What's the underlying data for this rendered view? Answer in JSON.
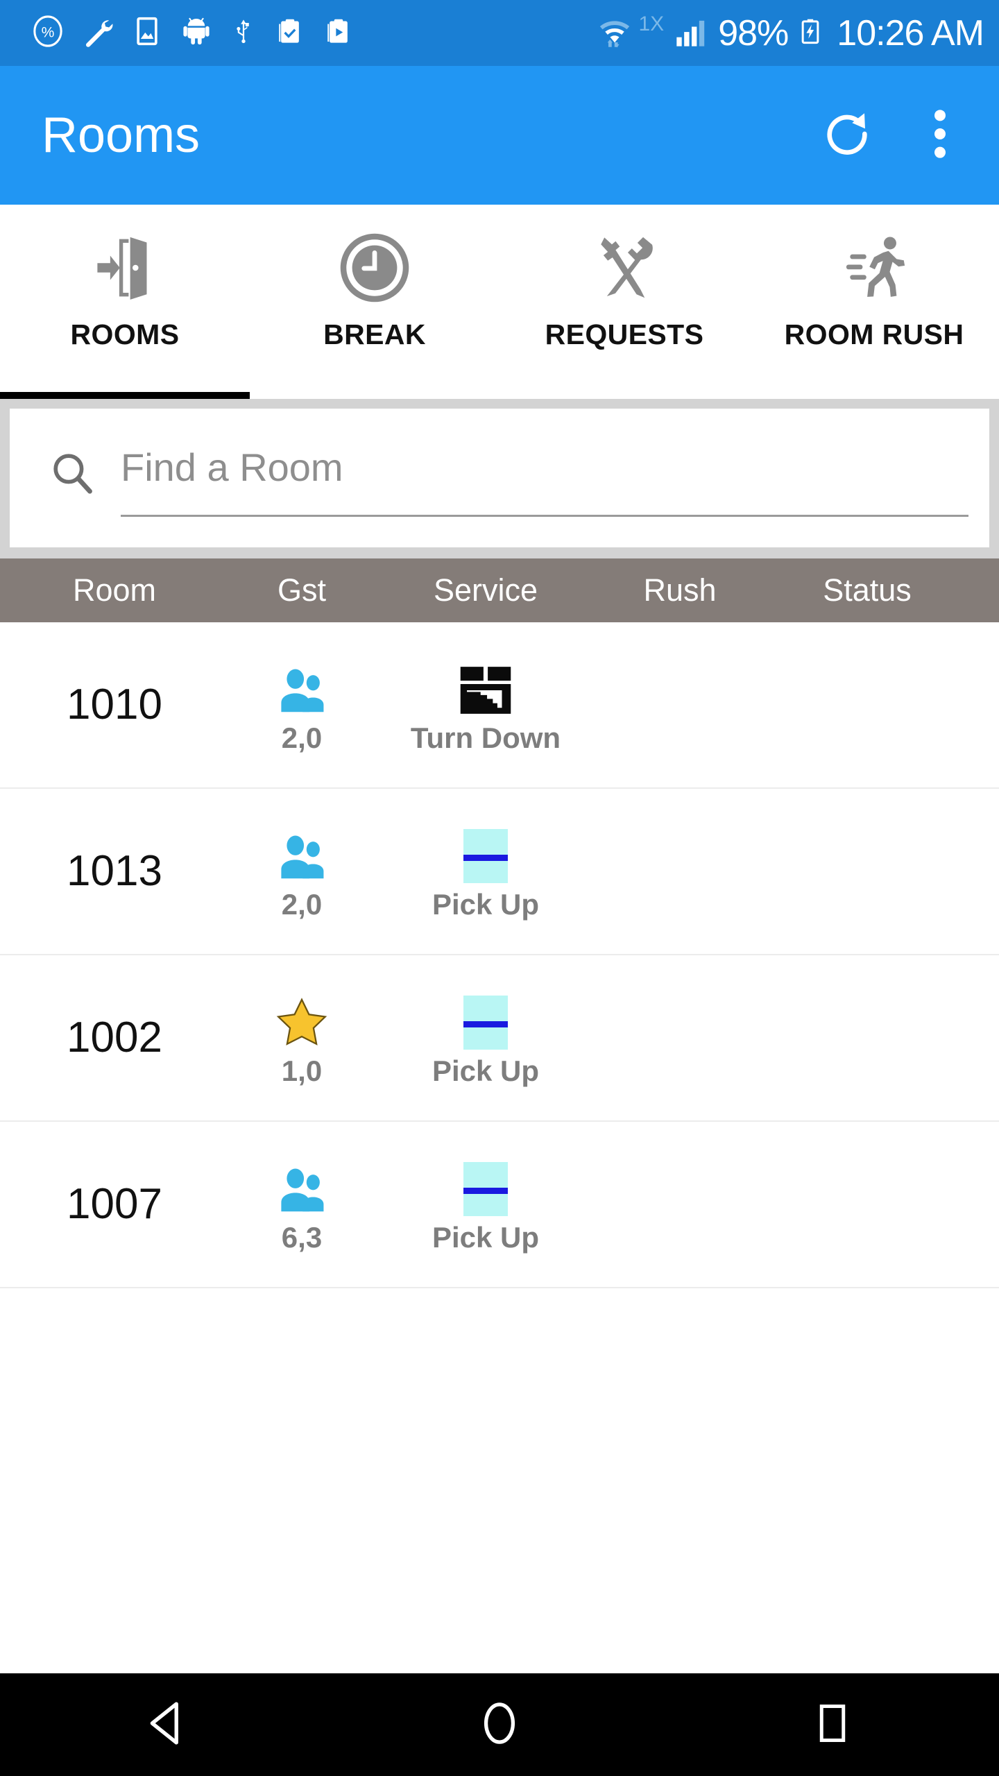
{
  "status_bar": {
    "background": "#1a7fd4",
    "left_icons": [
      "percent-circle-icon",
      "wrench-icon",
      "gallery-icon",
      "android-bug-icon",
      "usb-icon",
      "clipboard-check-icon",
      "clipboard-play-icon"
    ],
    "network_type": "1X",
    "wifi_icon": "wifi-icon",
    "signal_icon": "cellular-signal-icon",
    "battery_percent": "98%",
    "battery_icon": "battery-charging-icon",
    "clock": "10:26 AM"
  },
  "app_bar": {
    "title": "Rooms",
    "background": "#2196f3",
    "refresh_icon": "refresh-icon",
    "overflow_icon": "more-vertical-icon"
  },
  "tabs": {
    "active_index": 0,
    "indicator_color": "#000000",
    "items": [
      {
        "label": "ROOMS",
        "icon": "door-exit-icon"
      },
      {
        "label": "BREAK",
        "icon": "clock-icon"
      },
      {
        "label": "REQUESTS",
        "icon": "tools-icon"
      },
      {
        "label": "ROOM RUSH",
        "icon": "running-person-icon"
      }
    ]
  },
  "search": {
    "icon": "search-icon",
    "placeholder": "Find a Room",
    "value": ""
  },
  "table": {
    "header_background": "#847c78",
    "columns": [
      {
        "key": "room",
        "label": "Room"
      },
      {
        "key": "gst",
        "label": "Gst"
      },
      {
        "key": "service",
        "label": "Service"
      },
      {
        "key": "rush",
        "label": "Rush"
      },
      {
        "key": "status",
        "label": "Status"
      }
    ],
    "guest_icon_color": "#36b4e5",
    "vip_star_color": "#f7c32e",
    "rows": [
      {
        "room": "1010",
        "gst_icon": "two-people-icon",
        "gst": "2,0",
        "service_icon": "bed-turn-down-icon",
        "service": "Turn Down",
        "rush": "",
        "status": ""
      },
      {
        "room": "1013",
        "gst_icon": "two-people-icon",
        "gst": "2,0",
        "service_icon": "pick-up-icon",
        "service": "Pick Up",
        "rush": "",
        "status": ""
      },
      {
        "room": "1002",
        "gst_icon": "vip-star-icon",
        "gst": "1,0",
        "service_icon": "pick-up-icon",
        "service": "Pick Up",
        "rush": "",
        "status": ""
      },
      {
        "room": "1007",
        "gst_icon": "two-people-icon",
        "gst": "6,3",
        "service_icon": "pick-up-icon",
        "service": "Pick Up",
        "rush": "",
        "status": ""
      }
    ]
  },
  "nav_bar": {
    "background": "#000000",
    "buttons": [
      {
        "name": "back-button",
        "icon": "back-triangle-icon"
      },
      {
        "name": "home-button",
        "icon": "home-circle-icon"
      },
      {
        "name": "recents-button",
        "icon": "recents-square-icon"
      }
    ]
  }
}
